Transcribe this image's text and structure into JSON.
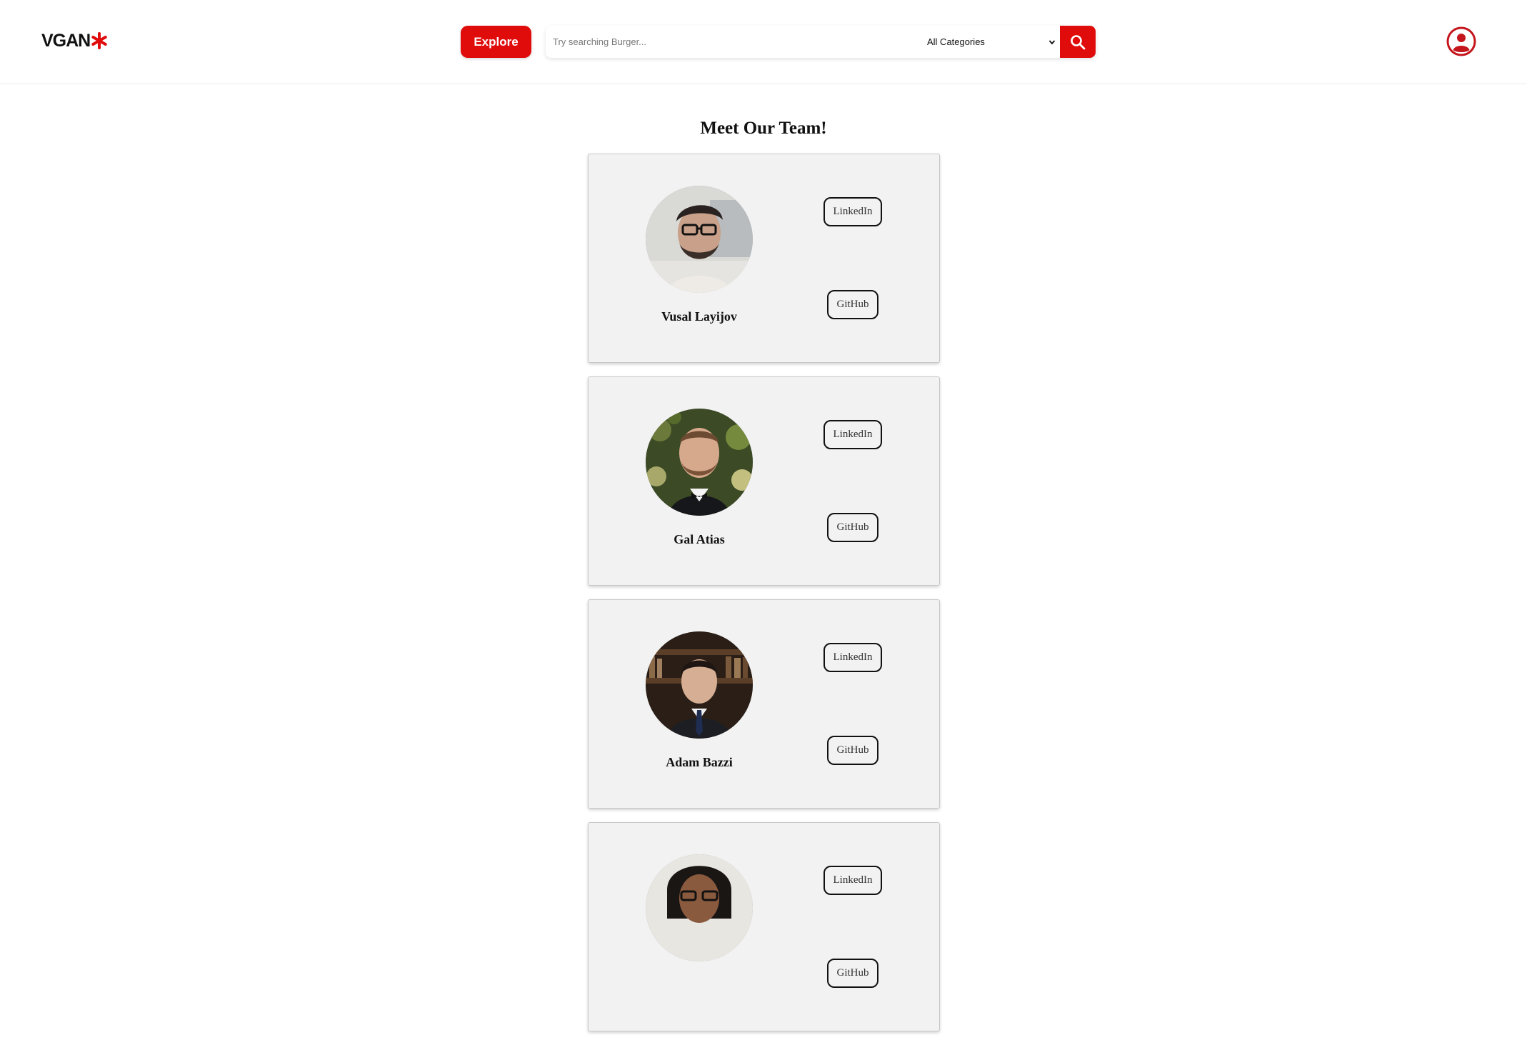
{
  "header": {
    "logo_text": "VGAN",
    "explore_label": "Explore",
    "search_placeholder": "Try searching Burger...",
    "category_selected": "All Categories"
  },
  "colors": {
    "brand_red": "#e00b0b",
    "card_bg": "#f2f2f2"
  },
  "icons": {
    "logo": "asterisk-icon",
    "search": "search-icon",
    "user": "user-circle-icon",
    "select": "chevron-down-icon"
  },
  "main": {
    "title": "Meet Our Team!",
    "members": [
      {
        "name": "Vusal Layijov",
        "linkedin_label": "LinkedIn",
        "github_label": "GitHub"
      },
      {
        "name": "Gal Atias",
        "linkedin_label": "LinkedIn",
        "github_label": "GitHub"
      },
      {
        "name": "Adam Bazzi",
        "linkedin_label": "LinkedIn",
        "github_label": "GitHub"
      },
      {
        "name": "",
        "linkedin_label": "LinkedIn",
        "github_label": "GitHub"
      }
    ]
  }
}
